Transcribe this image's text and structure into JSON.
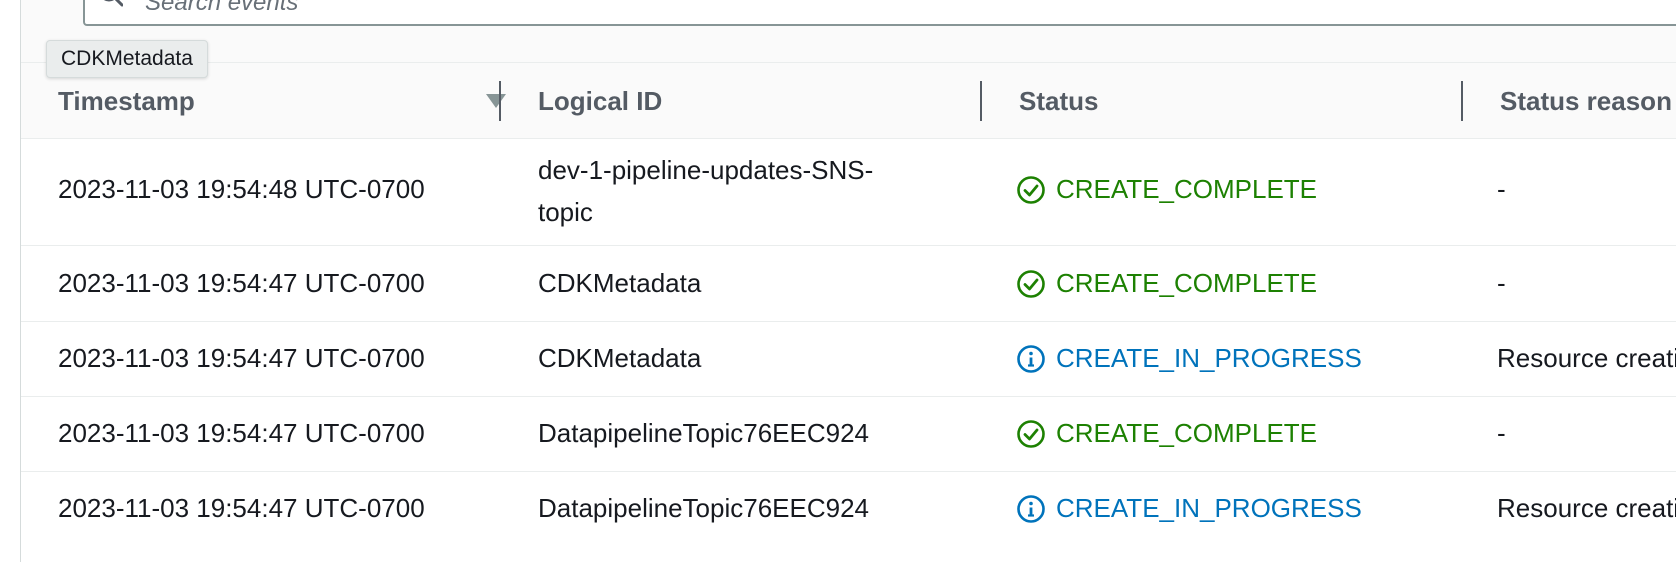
{
  "search": {
    "placeholder": "Search events"
  },
  "tooltip": {
    "text": "CDKMetadata"
  },
  "columns": [
    {
      "label": "Timestamp"
    },
    {
      "label": "Logical ID"
    },
    {
      "label": "Status"
    },
    {
      "label": "Status reason"
    }
  ],
  "sort": {
    "column": "Timestamp",
    "direction": "descending"
  },
  "rows": [
    {
      "timestamp": "2023-11-03 19:54:48 UTC-0700",
      "logical_id": "dev-1-pipeline-updates-SNS-topic",
      "status": "CREATE_COMPLETE",
      "status_icon": "check-circle-icon",
      "status_reason": "-"
    },
    {
      "timestamp": "2023-11-03 19:54:47 UTC-0700",
      "logical_id": "CDKMetadata",
      "status": "CREATE_COMPLETE",
      "status_icon": "check-circle-icon",
      "status_reason": "-"
    },
    {
      "timestamp": "2023-11-03 19:54:47 UTC-0700",
      "logical_id": "CDKMetadata",
      "status": "CREATE_IN_PROGRESS",
      "status_icon": "info-circle-icon",
      "status_reason": "Resource creation Initiated"
    },
    {
      "timestamp": "2023-11-03 19:54:47 UTC-0700",
      "logical_id": "DatapipelineTopic76EEC924",
      "status": "CREATE_COMPLETE",
      "status_icon": "check-circle-icon",
      "status_reason": "-"
    },
    {
      "timestamp": "2023-11-03 19:54:47 UTC-0700",
      "logical_id": "DatapipelineTopic76EEC924",
      "status": "CREATE_IN_PROGRESS",
      "status_icon": "info-circle-icon",
      "status_reason": "Resource creation Initiated"
    }
  ],
  "colors": {
    "status_complete": "#1d8102",
    "status_in_progress": "#0073bb",
    "header_text": "#545b64",
    "body_text": "#16191f"
  }
}
